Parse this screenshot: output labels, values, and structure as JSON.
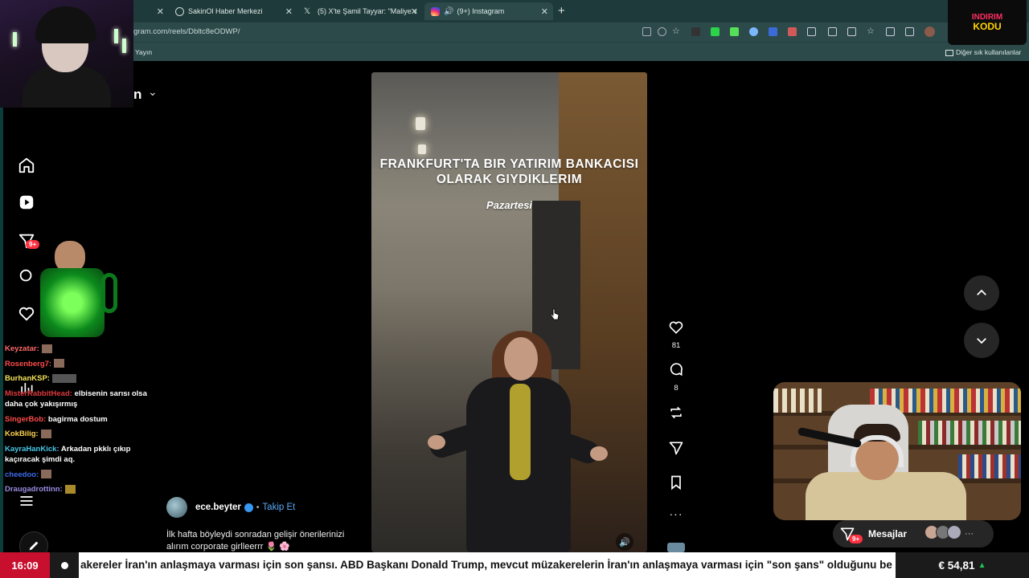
{
  "browser": {
    "tabs": [
      {
        "label": "",
        "icon": "tab-blank"
      },
      {
        "label": "SakinOl Haber Merkezi",
        "icon": "globe-icon"
      },
      {
        "label": "(5) X'te Şamil Tayyar: \"Maliye ve H",
        "icon": "x-logo-icon"
      },
      {
        "label": "(9+) Instagram",
        "icon": "instagram-icon"
      }
    ],
    "url": "gram.com/reels/Dbltc8eODWP/",
    "bookmarks": {
      "left": "Yayın",
      "right": "Diğer sık kullanılanlar"
    }
  },
  "page": {
    "brand_tail": "n",
    "nav_badge": "9+"
  },
  "reel": {
    "title_line1": "FRANKFURT'TA BIR YATIRIM BANKACISI",
    "title_line2": "OLARAK GIYDIKLERIM",
    "day": "Pazartesi",
    "owner": "ece.beyter",
    "follow_label": "Takip Et",
    "caption": "İlk hafta böyleydi sonradan gelişir önerilerinizi alırım corporate girlleerrr 🌷 🌸",
    "likes": "81",
    "comments": "8"
  },
  "messages": {
    "label": "Mesajlar",
    "badge": "9+"
  },
  "chat": [
    {
      "user": "Keyzatar:",
      "text": "",
      "color": "#ff6a6a"
    },
    {
      "user": "Rosenberg7:",
      "text": "",
      "color": "#ff4b4b"
    },
    {
      "user": "BurhanKSP:",
      "text": "",
      "color": "#f2e35a"
    },
    {
      "user": "MisterRabbitHead:",
      "text": "elbisenin sarısı olsa daha çok yakışırmış",
      "color": "#e0393e"
    },
    {
      "user": "SingerBob:",
      "text": "bagirma dostum",
      "color": "#ff4b4b"
    },
    {
      "user": "KokBilig:",
      "text": "",
      "color": "#ffd34d"
    },
    {
      "user": "KayraHanKick:",
      "text": "Arkadan pkklı çıkıp kaçıracak şimdi aq.",
      "color": "#47c9e8"
    },
    {
      "user": "cheedoo:",
      "text": "",
      "color": "#3d6ae8"
    },
    {
      "user": "Draugadrottinn:",
      "text": "",
      "color": "#9a8be0"
    }
  ],
  "ticker": {
    "time": "16:09",
    "news": "akereler İran'ın anlaşmaya varması için son şansı. ABD Başkanı Donald Trump, mevcut müzakerelerin İran'ın anlaşmaya varması için \"son şans\" olduğunu be",
    "fx": "€ 54,81"
  },
  "overlay_logo": {
    "line1": "INDIRIM",
    "line2": "KODU"
  },
  "colors": {
    "chrome": "#2c4a4a",
    "accent_red": "#c8102e",
    "link_blue": "#5aa9f5",
    "badge_red": "#ff3040"
  }
}
